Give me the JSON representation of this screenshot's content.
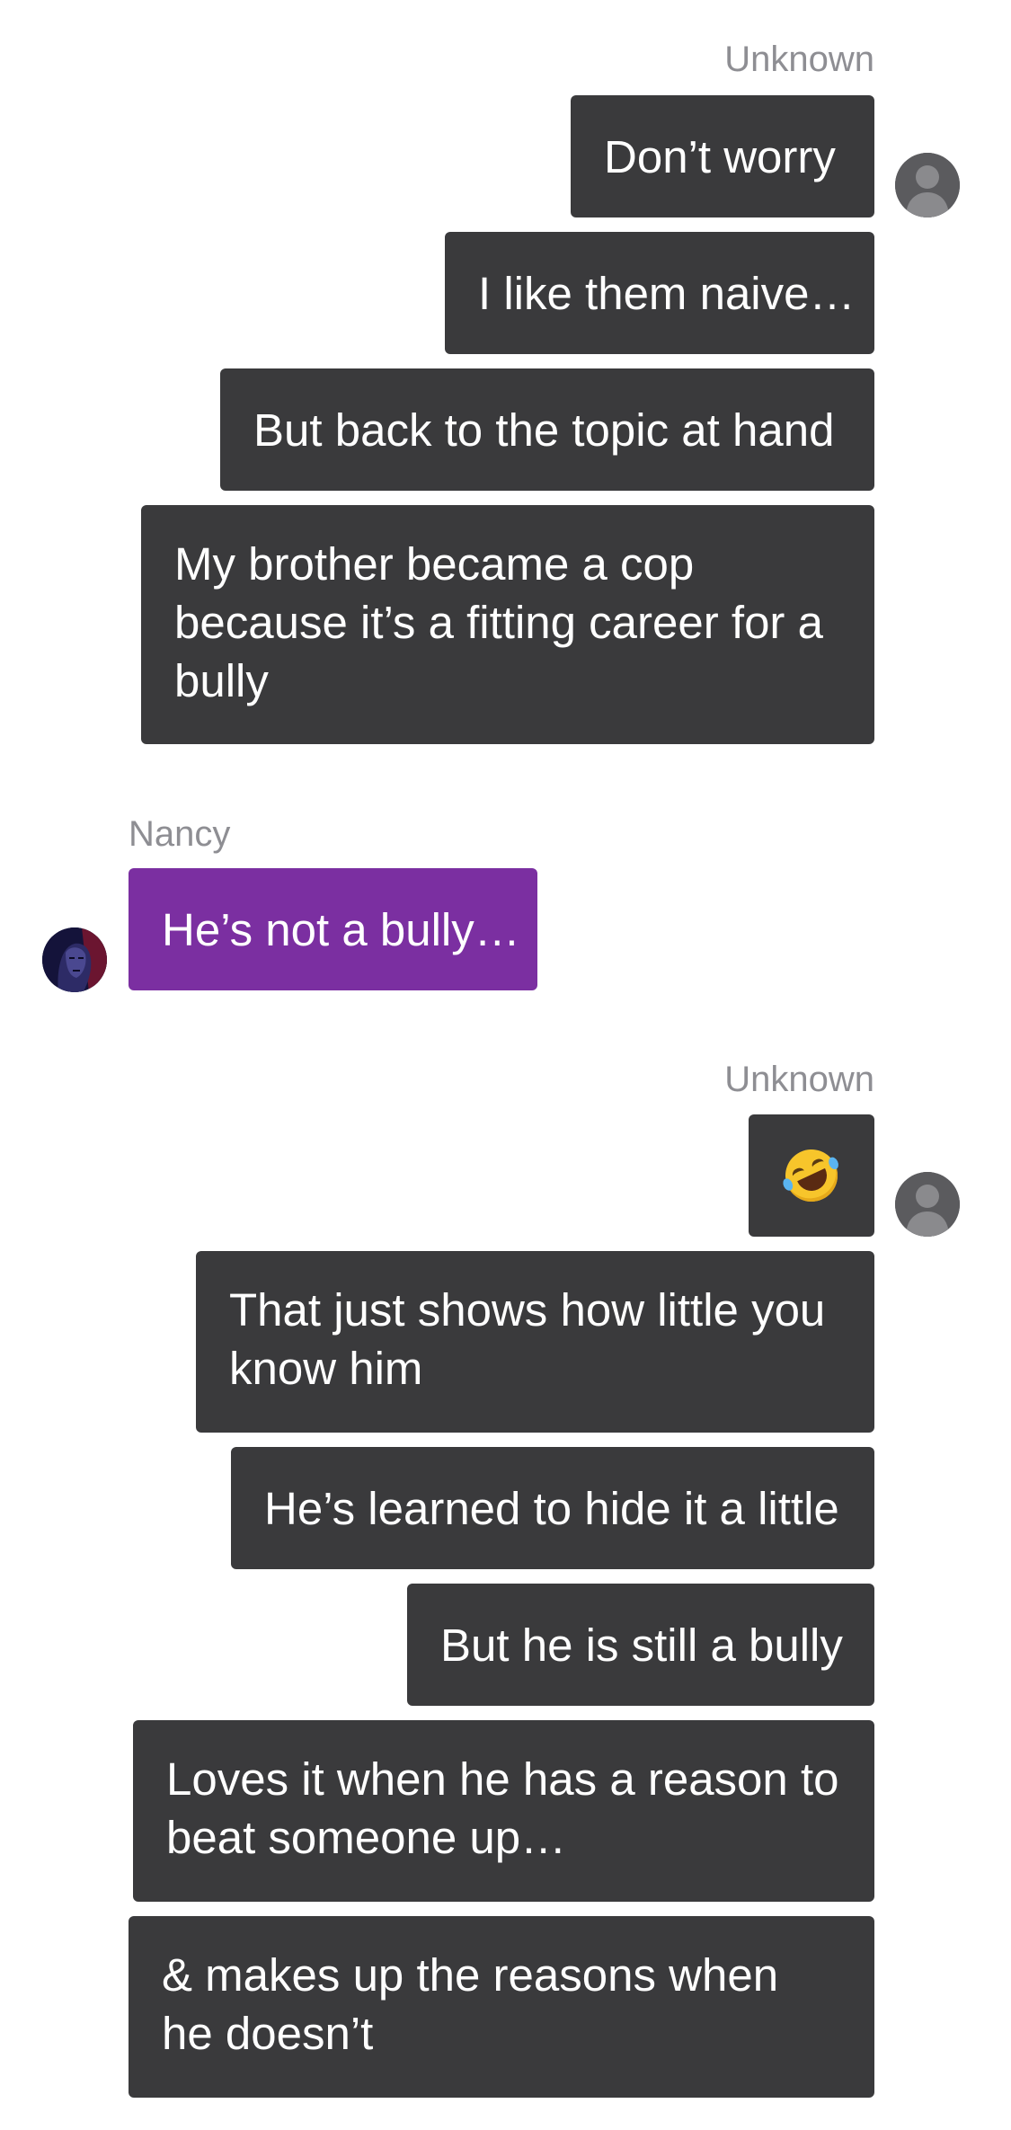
{
  "conversation": {
    "groups": [
      {
        "sender": "Unknown",
        "side": "right",
        "avatar_icon": "default-user-avatar-icon",
        "messages": [
          "Don’t worry",
          "I like them naive…",
          "But back to the topic at hand",
          "My brother became a cop because it’s a fitting career for a bully"
        ]
      },
      {
        "sender": "Nancy",
        "side": "left",
        "avatar_icon": "nancy-avatar-icon",
        "messages": [
          "He’s not a bully…"
        ]
      },
      {
        "sender": "Unknown",
        "side": "right",
        "avatar_icon": "default-user-avatar-icon",
        "messages": [
          "rolling-on-the-floor-laughing-emoji",
          "That just shows how little you know him",
          "He’s learned to hide it a little",
          "But he is still a bully",
          "Loves it when he has a reason to beat someone up…",
          "& makes up the reasons when he doesn’t"
        ]
      }
    ]
  },
  "colors": {
    "outgoing_bubble": "#3a3a3c",
    "incoming_bubble": "#7b2fa1",
    "sender_name": "#8e8e93",
    "background": "#ffffff",
    "bubble_text": "#ffffff"
  }
}
